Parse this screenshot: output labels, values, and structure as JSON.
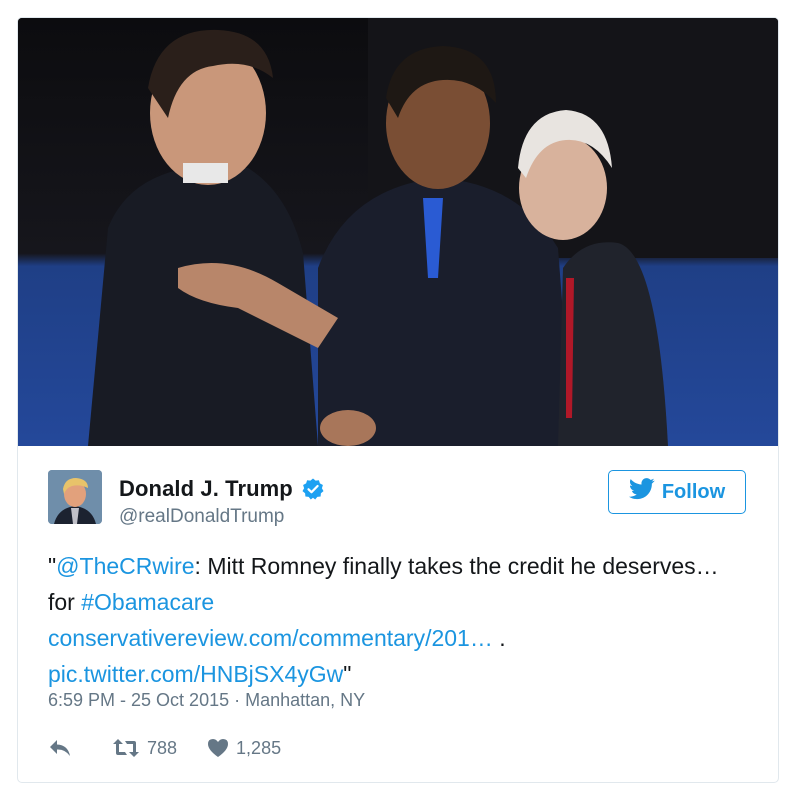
{
  "photo": {
    "alt": "three men on debate stage"
  },
  "author": {
    "display_name": "Donald J. Trump",
    "handle": "@realDonaldTrump",
    "verified": true
  },
  "follow": {
    "label": "Follow"
  },
  "tweet": {
    "quote_open": "\"",
    "mention": "@TheCRwire",
    "text_1": ": Mitt Romney finally takes the credit he deserves… for ",
    "hashtag": "#Obamacare",
    "url": "conservativereview.com/commentary/201…",
    "sep": " . ",
    "pic": "pic.twitter.com/HNBjSX4yGw",
    "quote_close": "\""
  },
  "meta": {
    "timestamp": "6:59 PM - 25 Oct 2015",
    "dot": " · ",
    "location": "Manhattan, NY"
  },
  "stats": {
    "retweets": "788",
    "likes": "1,285"
  },
  "colors": {
    "link": "#1b95e0",
    "secondary": "#657786",
    "verified": "#1da1f2"
  },
  "icons": [
    "reply-icon",
    "retweet-icon",
    "heart-icon",
    "twitter-bird-icon",
    "verified-icon"
  ]
}
